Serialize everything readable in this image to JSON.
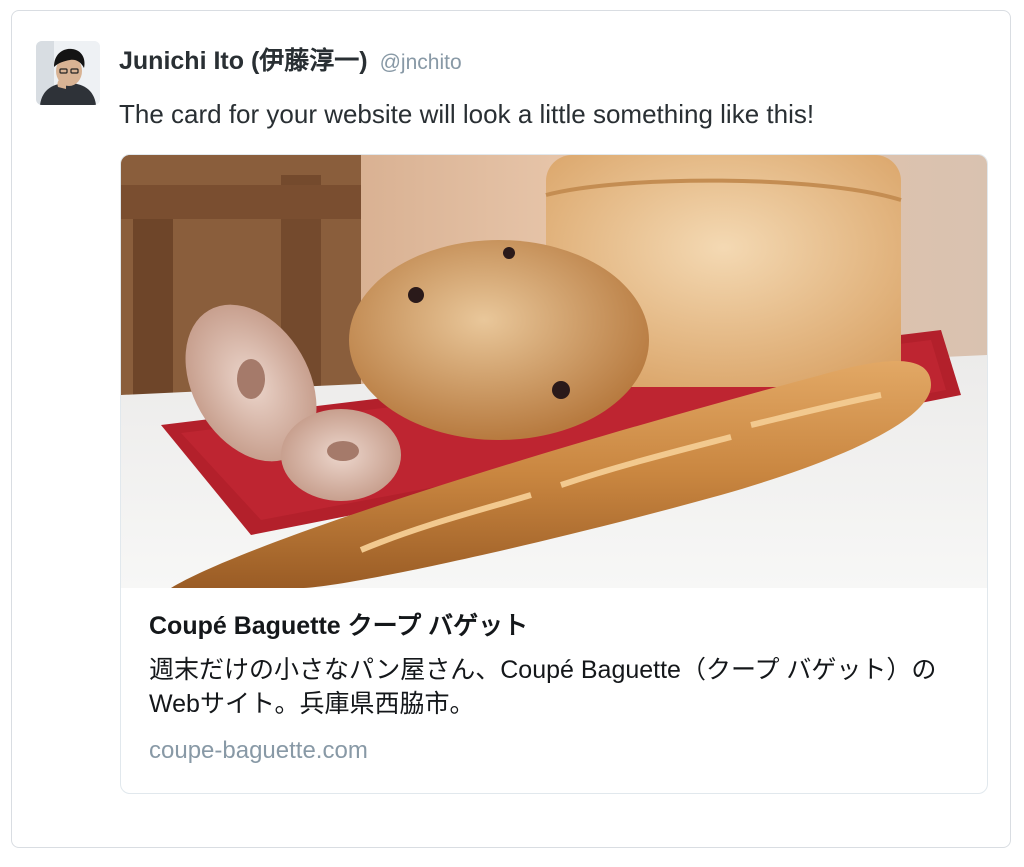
{
  "author": {
    "display_name": "Junichi Ito (伊藤淳一)",
    "handle": "@jnchito",
    "avatar_icon": "user-avatar-photo"
  },
  "tweet": {
    "text": "The card for your website will look a little something like this!"
  },
  "card": {
    "image_icon": "bread-photo",
    "title": "Coupé Baguette クープ バゲット",
    "description": "週末だけの小さなパン屋さん、Coupé Baguette（クープ バゲット）のWebサイト。兵庫県西脇市。",
    "domain": "coupe-baguette.com"
  },
  "colors": {
    "name_text": "#292f33",
    "secondary_text": "#8899a6",
    "border": "#e1e8ed",
    "tray_red": "#b3202b"
  }
}
